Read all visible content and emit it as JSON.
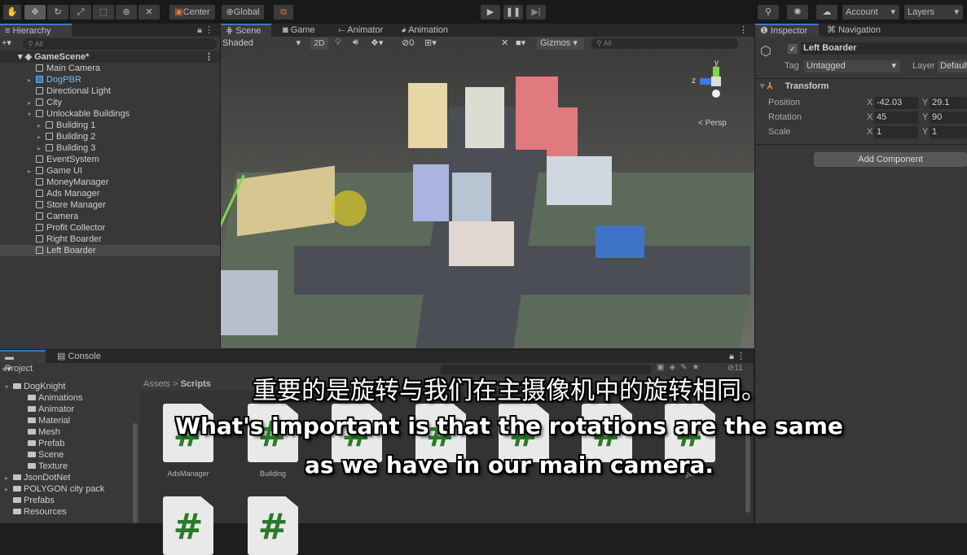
{
  "toolbar": {
    "tools": [
      "hand-icon",
      "move-icon",
      "rotate-icon",
      "scale-icon",
      "rect-icon",
      "transform-icon",
      "custom-tool-icon"
    ],
    "pivot": "Center",
    "space": "Global",
    "account": "Account",
    "layers": "Layers"
  },
  "hierarchy": {
    "title": "Hierarchy",
    "search_placeholder": "All",
    "scene": "GameScene*",
    "items": [
      {
        "label": "Main Camera",
        "depth": 1
      },
      {
        "label": "DogPBR",
        "depth": 1,
        "expandable": true,
        "prefab": true
      },
      {
        "label": "Directional Light",
        "depth": 1
      },
      {
        "label": "City",
        "depth": 1,
        "expandable": true
      },
      {
        "label": "Unlockable Buildings",
        "depth": 1,
        "expanded": true
      },
      {
        "label": "Building 1",
        "depth": 2,
        "expandable": true
      },
      {
        "label": "Building 2",
        "depth": 2,
        "expandable": true
      },
      {
        "label": "Building 3",
        "depth": 2,
        "expandable": true
      },
      {
        "label": "EventSystem",
        "depth": 1
      },
      {
        "label": "Game UI",
        "depth": 1,
        "expandable": true
      },
      {
        "label": "MoneyManager",
        "depth": 1
      },
      {
        "label": "Ads Manager",
        "depth": 1
      },
      {
        "label": "Store Manager",
        "depth": 1
      },
      {
        "label": "Camera",
        "depth": 1
      },
      {
        "label": "Profit Collector",
        "depth": 1
      },
      {
        "label": "Right Boarder",
        "depth": 1
      },
      {
        "label": "Left Boarder",
        "depth": 1,
        "selected": true
      }
    ]
  },
  "scene": {
    "tabs": [
      "Scene",
      "Game",
      "Animator",
      "Animation"
    ],
    "shading": "Shaded",
    "mode_2d": "2D",
    "hidden_count": "0",
    "gizmos": "Gizmos",
    "search_placeholder": "All",
    "persp": "< Persp",
    "axis_y": "y",
    "axis_z": "z"
  },
  "inspector": {
    "tabs": [
      "Inspector",
      "Navigation"
    ],
    "object_name": "Left Boarder",
    "active": true,
    "tag_label": "Tag",
    "tag": "Untagged",
    "layer_label": "Layer",
    "layer": "Default",
    "component": "Transform",
    "rows": [
      {
        "label": "Position",
        "x": "-42.03",
        "y": "29.1"
      },
      {
        "label": "Rotation",
        "x": "45",
        "y": "90"
      },
      {
        "label": "Scale",
        "x": "1",
        "y": "1"
      }
    ],
    "x_label": "X",
    "y_label": "Y",
    "add_component": "Add Component"
  },
  "project": {
    "tabs": [
      "Project",
      "Console"
    ],
    "tree": [
      {
        "label": "DogKnight",
        "depth": 0,
        "expanded": true
      },
      {
        "label": "Animations",
        "depth": 1
      },
      {
        "label": "Animator",
        "depth": 1
      },
      {
        "label": "Material",
        "depth": 1
      },
      {
        "label": "Mesh",
        "depth": 1
      },
      {
        "label": "Prefab",
        "depth": 1
      },
      {
        "label": "Scene",
        "depth": 1
      },
      {
        "label": "Texture",
        "depth": 1
      },
      {
        "label": "JsonDotNet",
        "depth": 0,
        "expandable": true
      },
      {
        "label": "POLYGON city pack",
        "depth": 0,
        "expandable": true
      },
      {
        "label": "Prefabs",
        "depth": 0
      },
      {
        "label": "Resources",
        "depth": 0
      }
    ],
    "breadcrumb": [
      "Assets",
      "Scripts"
    ],
    "hidden_count": "11",
    "scripts": [
      "AdsManager",
      "Building",
      "",
      "",
      "",
      "",
      "ger"
    ]
  },
  "subtitles": {
    "zh": "重要的是旋转与我们在主摄像机中的旋转相同。",
    "en1": "What's important is that the rotations are the same",
    "en2": "as we have in our main camera."
  },
  "colors": {
    "selection": "#2c5d87",
    "accent": "#3a79bb",
    "script_hash": "#2a7a2a"
  }
}
